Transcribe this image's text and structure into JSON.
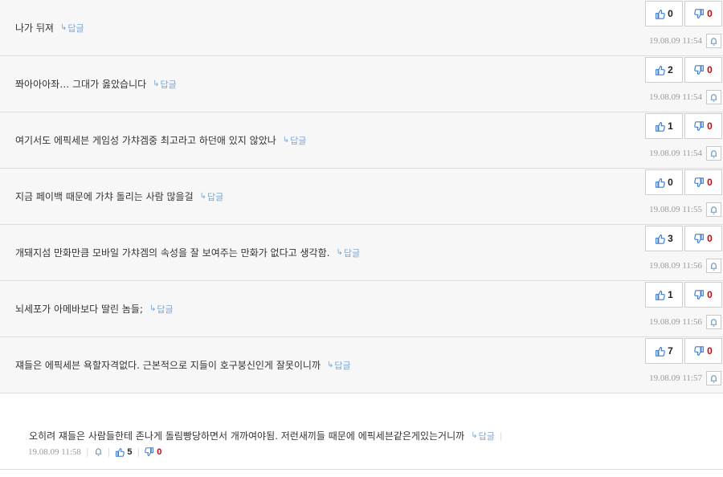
{
  "comments": [
    {
      "text": "나가 뒤져",
      "reply": "답글",
      "up": "0",
      "down": "0",
      "date": "19.08.09 11:54"
    },
    {
      "text": "쫘아아아좌… 그대가 옳았습니다",
      "reply": "답글",
      "up": "2",
      "down": "0",
      "date": "19.08.09 11:54"
    },
    {
      "text": "여기서도 에픽세븐 게임성 가챠겜중 최고라고 하던애 있지 않았나",
      "reply": "답글",
      "up": "1",
      "down": "0",
      "date": "19.08.09 11:54"
    },
    {
      "text": "지금 페이백 때문에 가챠 돌리는 사람 많을걸",
      "reply": "답글",
      "up": "0",
      "down": "0",
      "date": "19.08.09 11:55"
    },
    {
      "text": "개돼지섬 만화만큼 모바일 가챠겜의 속성을 잘 보여주는 만화가 없다고 생각함.",
      "reply": "답글",
      "up": "3",
      "down": "0",
      "date": "19.08.09 11:56"
    },
    {
      "text": "뇌세포가 아메바보다 딸린 놈들;",
      "reply": "답글",
      "up": "1",
      "down": "0",
      "date": "19.08.09 11:56"
    },
    {
      "text": "쟤들은 에픽세븐 욕할자격없다. 근본적으로 지들이 호구붕신인게 잘못이니까",
      "reply": "답글",
      "up": "7",
      "down": "0",
      "date": "19.08.09 11:57"
    }
  ],
  "last_comment": {
    "text": "오히려 쟤들은 사람들한테 존나게 돌림빵당하면서 개까여야됨. 저런새끼들 때문에 에픽세븐같은게있는거니까",
    "reply": "답글",
    "date": "19.08.09 11:58",
    "up": "5",
    "down": "0"
  },
  "icons": {
    "reply": "reply-arrow-icon",
    "up": "thumbs-up-icon",
    "down": "thumbs-down-icon",
    "report": "bell-report-icon"
  },
  "colors": {
    "thumb_up": "#3a7bd5",
    "thumb_down": "#3a7bd5",
    "down_count": "#d40000",
    "reply": "#7aa7d6"
  }
}
